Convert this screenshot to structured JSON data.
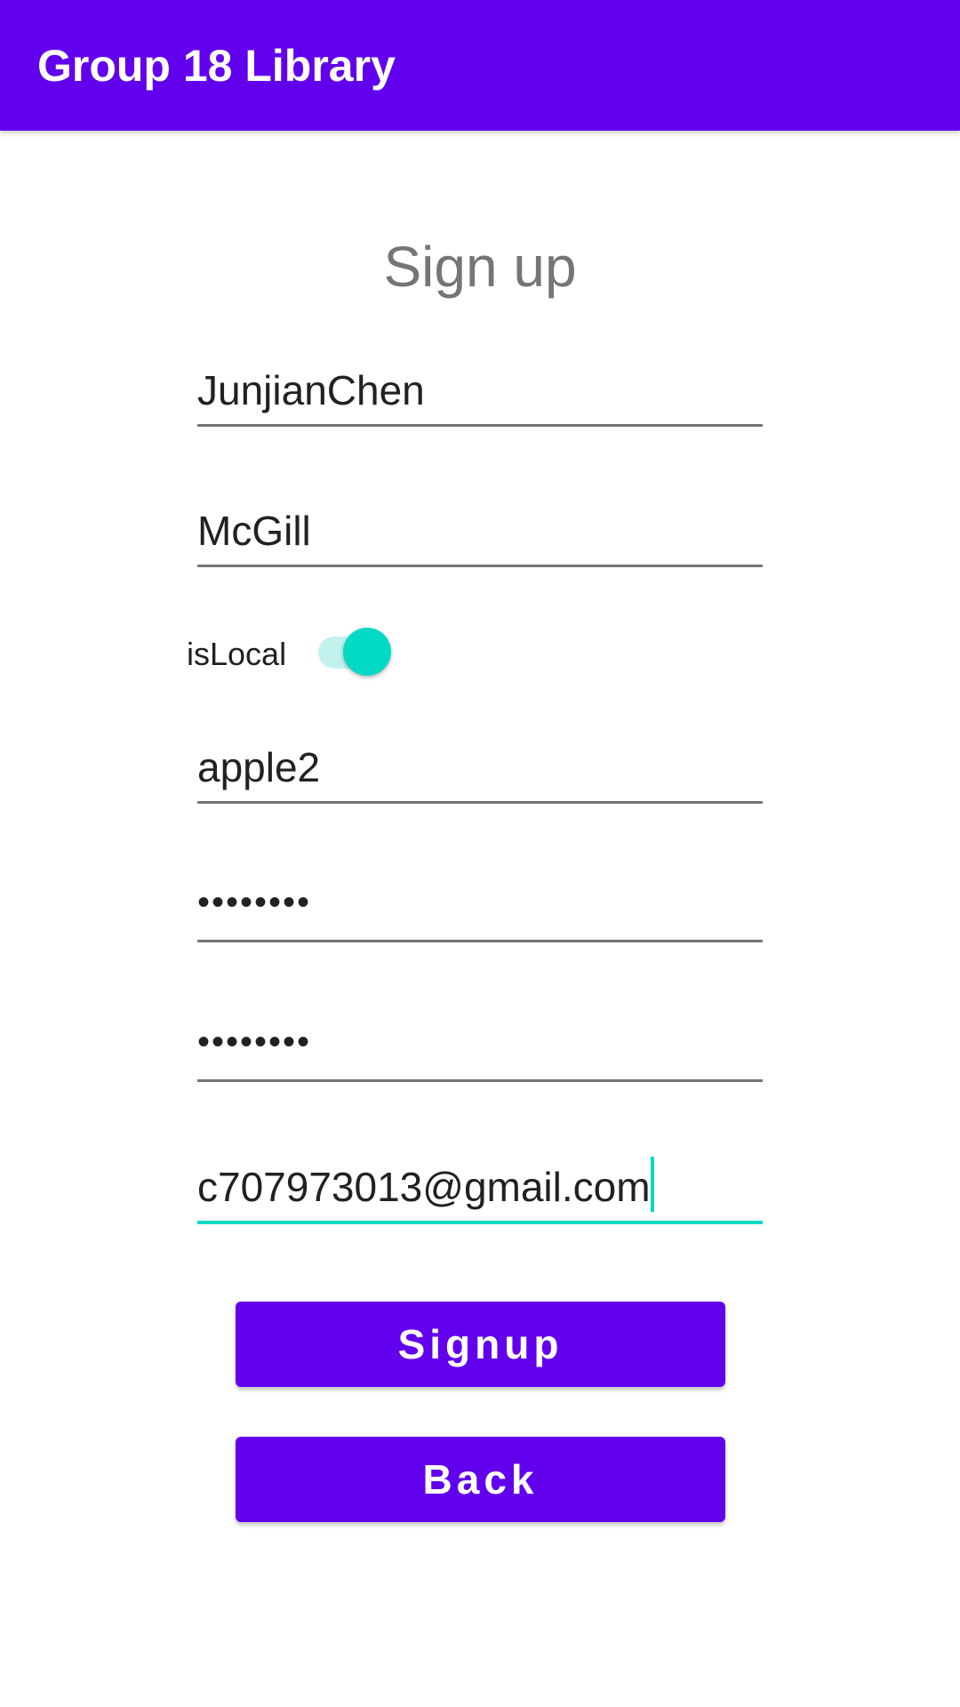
{
  "app_bar": {
    "title": "Group 18 Library",
    "color": "#6200EE"
  },
  "page": {
    "title": "Sign up"
  },
  "form": {
    "name": {
      "value": "JunjianChen"
    },
    "school": {
      "value": "McGill"
    },
    "is_local": {
      "label": "isLocal",
      "checked": true
    },
    "username": {
      "value": "apple2"
    },
    "password": {
      "value": "••••••••"
    },
    "confirm_password": {
      "value": "••••••••"
    },
    "email": {
      "value": "c707973013@gmail.com",
      "focused": true
    }
  },
  "buttons": {
    "signup_label": "Signup",
    "back_label": "Back"
  },
  "colors": {
    "primary": "#6200EE",
    "accent": "#03DAC5",
    "underline": "#757575"
  }
}
